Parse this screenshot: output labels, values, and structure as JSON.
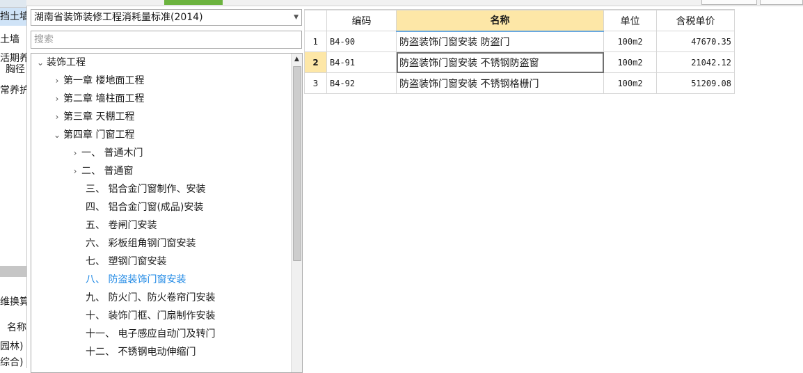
{
  "left_strip": {
    "items": [
      "挡土墙",
      "土墙",
      "活期养",
      "胸径",
      "常养护",
      "维换算",
      "名称",
      "园林)",
      "综合)"
    ]
  },
  "dropdown": {
    "selected": "湖南省装饰装修工程消耗量标准(2014)",
    "arrow": "chevron-down-icon"
  },
  "search": {
    "placeholder": "搜索",
    "value": ""
  },
  "tree": {
    "root": "装饰工程",
    "chapters": [
      "第一章 楼地面工程",
      "第二章 墙柱面工程",
      "第三章 天棚工程",
      "第四章 门窗工程"
    ],
    "sections": [
      "一、 普通木门",
      "二、 普通窗",
      "三、 铝合金门窗制作、安装",
      "四、 铝合金门窗(成品)安装",
      "五、 卷闸门安装",
      "六、 彩板组角钢门窗安装",
      "七、 塑钢门窗安装",
      "八、 防盗装饰门窗安装",
      "九、 防火门、防火卷帘门安装",
      "十、 装饰门框、门扇制作安装",
      "十一、 电子感应自动门及转门",
      "十二、 不锈钢电动伸缩门"
    ],
    "selected_section_index": 7
  },
  "grid": {
    "headers": [
      "编码",
      "名称",
      "单位",
      "含税单价"
    ],
    "rows": [
      {
        "num": "1",
        "code": "B4-90",
        "name": "防盗装饰门窗安装 防盗门",
        "unit": "100m2",
        "price": "47670.35"
      },
      {
        "num": "2",
        "code": "B4-91",
        "name": "防盗装饰门窗安装 不锈钢防盗窗",
        "unit": "100m2",
        "price": "21042.12"
      },
      {
        "num": "3",
        "code": "B4-92",
        "name": "防盗装饰门窗安装 不锈钢格栅门",
        "unit": "100m2",
        "price": "51209.08"
      }
    ],
    "active_row_index": 1
  },
  "colors": {
    "accent_green": "#6cb33f",
    "header_highlight": "#fde7a7",
    "selected_text": "#1e88e5"
  }
}
